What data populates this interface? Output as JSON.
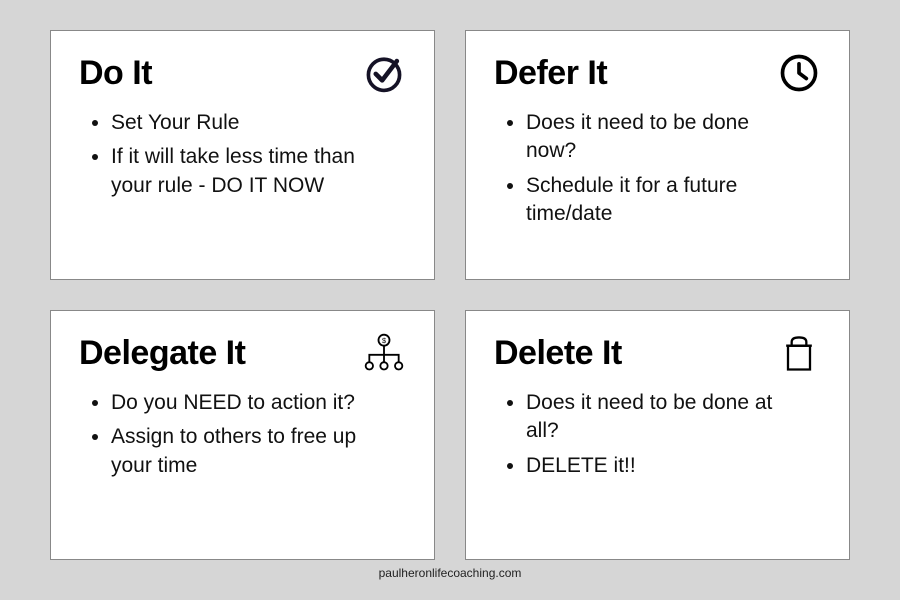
{
  "cards": [
    {
      "title": "Do It",
      "icon": "checkmark-circle-icon",
      "items": [
        "Set Your Rule",
        "If it will take less time than your rule - DO IT NOW"
      ]
    },
    {
      "title": "Defer It",
      "icon": "clock-icon",
      "items": [
        "Does it need to be done now?",
        "Schedule it for a future time/date"
      ]
    },
    {
      "title": "Delegate It",
      "icon": "org-chart-icon",
      "items": [
        "Do you NEED to action it?",
        "Assign to others to free up your time"
      ]
    },
    {
      "title": "Delete It",
      "icon": "trash-icon",
      "items": [
        "Does it need to be done at all?",
        "DELETE it!!"
      ]
    }
  ],
  "footer": "paulheronlifecoaching.com"
}
